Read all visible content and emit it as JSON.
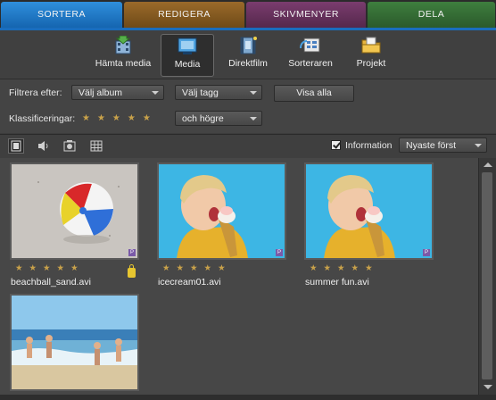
{
  "tabs": [
    {
      "label": "SORTERA",
      "active": true
    },
    {
      "label": "REDIGERA"
    },
    {
      "label": "SKIVMENYER"
    },
    {
      "label": "DELA"
    }
  ],
  "toolbar": {
    "items": [
      {
        "label": "Hämta media",
        "icon": "import-media-icon"
      },
      {
        "label": "Media",
        "icon": "media-view-icon",
        "active": true
      },
      {
        "label": "Direktfilm",
        "icon": "instant-movie-icon"
      },
      {
        "label": "Sorteraren",
        "icon": "sorter-icon"
      },
      {
        "label": "Projekt",
        "icon": "project-folder-icon"
      }
    ]
  },
  "filters": {
    "filter_label": "Filtrera efter:",
    "album_value": "Välj album",
    "tag_value": "Välj tagg",
    "show_all": "Visa alla",
    "rating_label": "Klassificeringar:",
    "rating_stars": "★★★★★",
    "rating_compare": "och högre"
  },
  "viewbar": {
    "information_label": "Information",
    "information_checked": true,
    "sort_value": "Nyaste först"
  },
  "media": [
    {
      "name": "beachball_sand.avi",
      "stars": "★★★★★",
      "locked": true,
      "badge": "P"
    },
    {
      "name": "icecream01.avi",
      "stars": "★★★★★",
      "badge": "P"
    },
    {
      "name": "summer fun.avi",
      "stars": "★★★★★",
      "badge": "P"
    },
    {
      "name": "",
      "stars": "",
      "badge": ""
    }
  ],
  "colors": {
    "accent": "#1a6dbd",
    "star": "#c9a24a",
    "lock": "#e7c630"
  }
}
